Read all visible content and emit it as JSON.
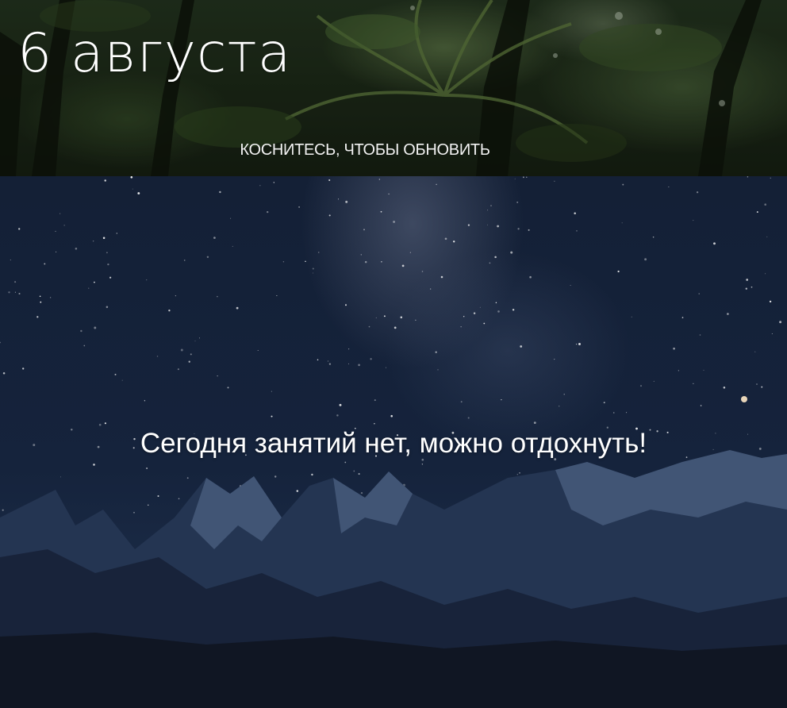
{
  "header": {
    "date_title": "6 августа",
    "refresh_hint": "КОСНИТЕСЬ, ЧТОБЫ ОБНОВИТЬ",
    "background_image": "forest-canopy-photo"
  },
  "main": {
    "empty_message": "Сегодня занятий нет, можно отдохнуть!",
    "background_image": "starry-sky-mountains-photo"
  },
  "colors": {
    "text": "#ffffff",
    "header_bg": "#1d2a18",
    "main_bg": "#15233c"
  }
}
